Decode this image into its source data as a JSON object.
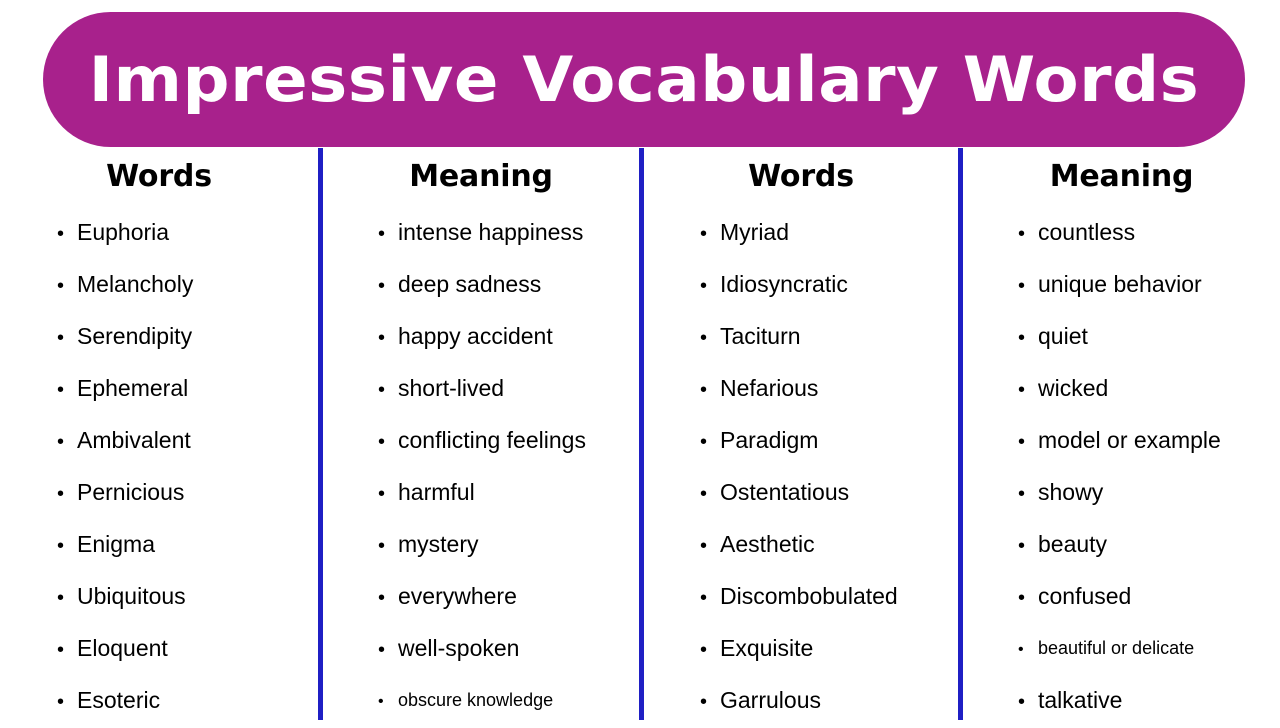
{
  "banner": {
    "title": "Impressive Vocabulary Words",
    "background_color": "#A8218C",
    "text_color": "#FFFFFF"
  },
  "divider_color": "#1F1FC4",
  "columns": [
    {
      "header": "Words",
      "items": [
        "Euphoria",
        "Melancholy",
        "Serendipity",
        "Ephemeral",
        "Ambivalent",
        "Pernicious",
        "Enigma",
        "Ubiquitous",
        "Eloquent",
        "Esoteric"
      ]
    },
    {
      "header": "Meaning",
      "items": [
        "intense happiness",
        "deep sadness",
        "happy accident",
        "short-lived",
        "conflicting feelings",
        "harmful",
        "mystery",
        "everywhere",
        "well-spoken",
        "obscure knowledge"
      ]
    },
    {
      "header": "Words",
      "items": [
        "Myriad",
        "Idiosyncratic",
        "Taciturn",
        "Nefarious",
        "Paradigm",
        "Ostentatious",
        "Aesthetic",
        "Discombobulated",
        "Exquisite",
        "Garrulous"
      ]
    },
    {
      "header": "Meaning",
      "items": [
        "countless",
        "unique behavior",
        "quiet",
        "wicked",
        "model or example",
        "showy",
        "beauty",
        "confused",
        "beautiful or delicate",
        "talkative"
      ]
    }
  ],
  "small_items": [
    "obscure knowledge",
    "beautiful or delicate"
  ],
  "bullet_glyph": "•"
}
